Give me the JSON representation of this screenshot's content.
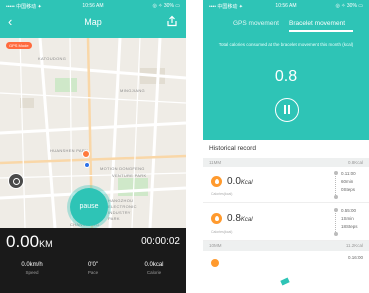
{
  "left_screen": {
    "status_bar": {
      "carrier": "••••• 中国移动 ✦",
      "time": "10:56 AM",
      "battery": "◎ ✧ 30% ▭"
    },
    "title": "Map",
    "back_icon": "chevron-left-icon",
    "share_icon": "share-icon",
    "map": {
      "gps_badge": "GPS Mode",
      "labels": [
        "KATOUDONG",
        "MINGJIANG",
        "HUANSHEN PARK",
        "MOTION DONGFENG",
        "VENTURE PARK",
        "HANGZHOU",
        "ELECTRONIC",
        "INDUSTRY",
        "PARK",
        "CHANGJIANG"
      ],
      "pause_label": "pause"
    },
    "stats": {
      "distance_value": "0.00",
      "distance_unit": "KM",
      "duration": "00:00:02",
      "speed_value": "0.0km/h",
      "speed_label": "Speed",
      "pace_value": "0'0\"",
      "pace_label": "Pace",
      "calorie_value": "0.0kcal",
      "calorie_label": "Calorie"
    }
  },
  "right_screen": {
    "status_bar": {
      "carrier": "•••• 中国移动 ✦",
      "time": "10:56 AM",
      "battery": "◎ ✧ 30% ▭"
    },
    "tabs": [
      {
        "label": "GPS movement"
      },
      {
        "label": "Bracelet movement"
      }
    ],
    "caption": "Total calories consumed at the bracelet movement this month (kcal)",
    "total_value": "0.8",
    "history_title": "Historical record",
    "groups": [
      {
        "month": "11MM",
        "total": "0.8Kcal"
      },
      {
        "month": "10MM",
        "total": "11.2Kcal"
      }
    ],
    "entries": [
      {
        "value": "0.0",
        "unit": "Kcal",
        "sub": "Calories(kcal)",
        "time": "0.11:00",
        "duration": "60min",
        "steps": "0Steps"
      },
      {
        "value": "0.8",
        "unit": "Kcal",
        "sub": "Calories(kcal)",
        "time": "0.55:00",
        "duration": "1Smin",
        "steps": "18Steps"
      }
    ],
    "next_time": "0.16:00"
  }
}
